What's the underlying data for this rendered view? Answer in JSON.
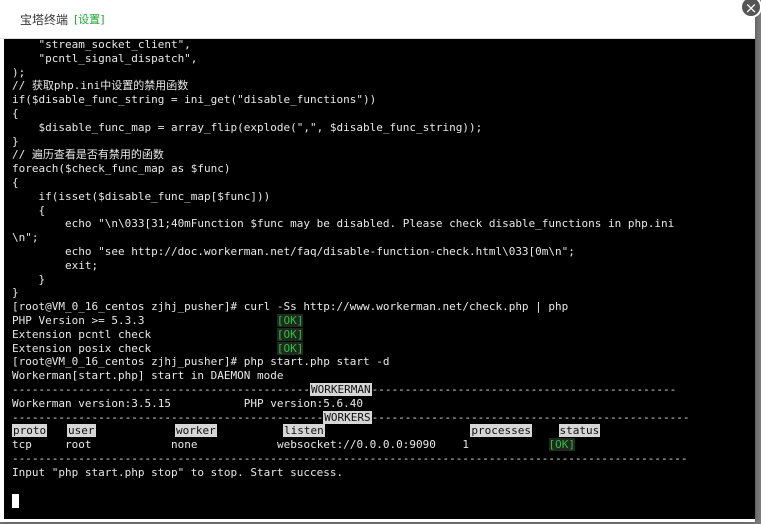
{
  "window": {
    "title": "宝塔终端",
    "settings_link": "[设置]",
    "close_label": "×"
  },
  "terminal": {
    "lines": [
      "    \"stream_socket_client\",",
      "    \"pcntl_signal_dispatch\",",
      ");",
      "// 获取php.ini中设置的禁用函数",
      "if($disable_func_string = ini_get(\"disable_functions\"))",
      "{",
      "    $disable_func_map = array_flip(explode(\",\", $disable_func_string));",
      "}",
      "// 遍历查看是否有禁用的函数",
      "foreach($check_func_map as $func)",
      "{",
      "    if(isset($disable_func_map[$func]))",
      "    {",
      "        echo \"\\n\\033[31;40mFunction $func may be disabled. Please check disable_functions in php.ini",
      "\\n\";",
      "        echo \"see http://doc.workerman.net/faq/disable-function-check.html\\033[0m\\n\";",
      "        exit;",
      "    }",
      "}",
      "[root@VM_0_16_centos zjhj_pusher]# curl -Ss http://www.workerman.net/check.php | php"
    ],
    "checks": [
      {
        "label": "PHP Version >= 5.3.3",
        "status": "[OK]"
      },
      {
        "label": "Extension pcntl check",
        "status": "[OK]"
      },
      {
        "label": "Extension posix check",
        "status": "[OK]"
      }
    ],
    "start_cmd": "[root@VM_0_16_centos zjhj_pusher]# php start.php start -d",
    "start_msg": "Workerman[start.php] start in DAEMON mode",
    "workerman_header": "WORKERMAN",
    "workerman_version": "Workerman version:3.5.15",
    "php_version": "PHP version:5.6.40",
    "workers_header": "WORKERS",
    "table": {
      "headers": [
        "proto",
        "user",
        "worker",
        "listen",
        "processes",
        "status"
      ],
      "row": [
        "tcp",
        "root",
        "none",
        "websocket://0.0.0.0:9090",
        "1",
        "[OK]"
      ]
    },
    "footer_msg": "Input \"php start.php stop\" to stop. Start success."
  }
}
